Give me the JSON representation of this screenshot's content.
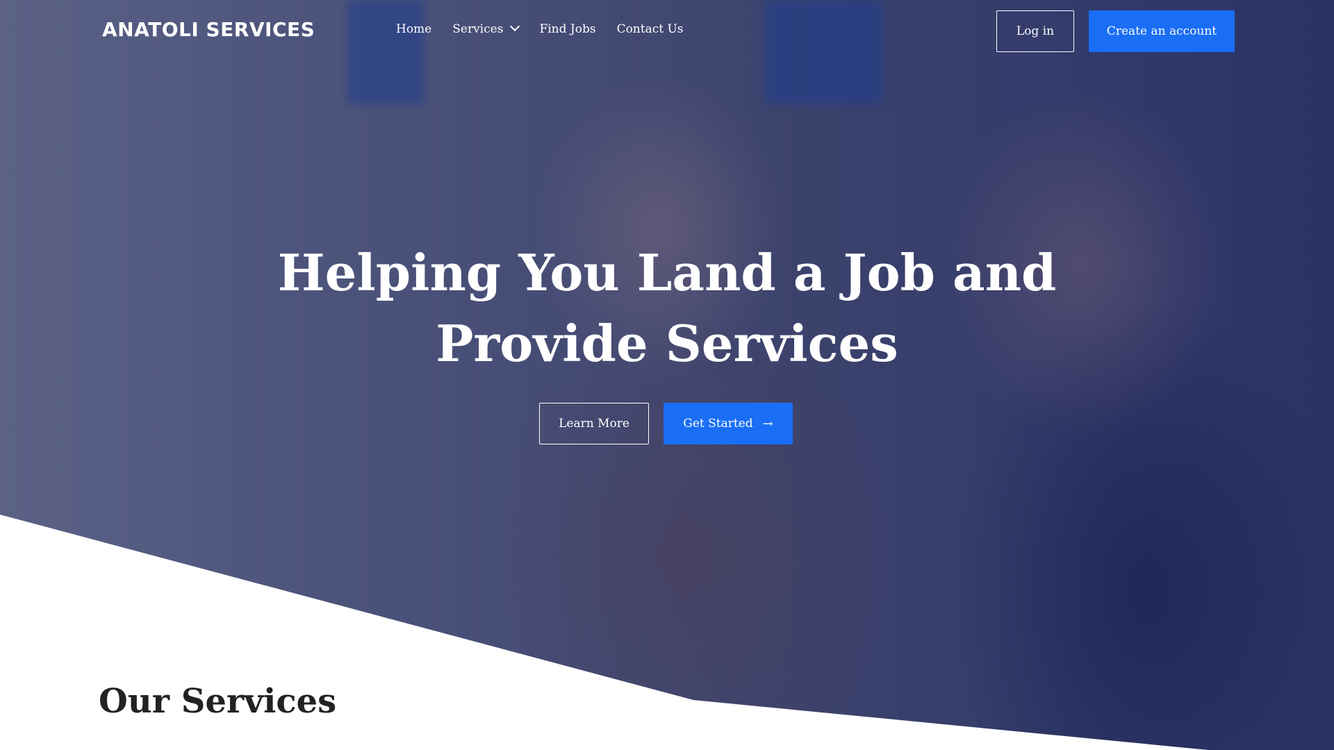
{
  "brand": {
    "logo": "ANATOLI SERVICES"
  },
  "nav": {
    "items": [
      {
        "label": "Home"
      },
      {
        "label": "Services",
        "has_dropdown": true
      },
      {
        "label": "Find Jobs"
      },
      {
        "label": "Contact Us"
      }
    ],
    "login_label": "Log in",
    "signup_label": "Create an account"
  },
  "hero": {
    "headline_line1": "Helping You Land a Job and",
    "headline_line2": "Provide Services",
    "learn_more_label": "Learn More",
    "get_started_label": "Get Started",
    "get_started_icon": "arrow-right-icon"
  },
  "services": {
    "title": "Our Services"
  },
  "colors": {
    "accent": "#1a6ef5",
    "overlay": "#2e376a"
  }
}
